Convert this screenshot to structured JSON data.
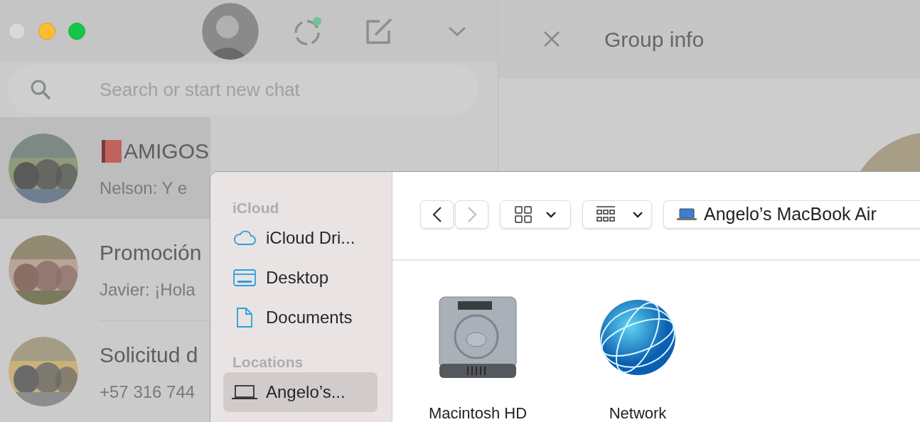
{
  "search": {
    "placeholder": "Search or start new chat"
  },
  "chats": [
    {
      "title": "AMIGOS",
      "preview": "Nelson: Y e",
      "selected": true
    },
    {
      "title": "Promoción",
      "preview": "Javier: ¡Hola",
      "selected": false
    },
    {
      "title": "Solicitud d",
      "preview": "+57 316 744",
      "selected": false
    }
  ],
  "group_info": {
    "title": "Group info"
  },
  "dialog": {
    "sidebar": [
      {
        "heading": "iCloud",
        "items": [
          {
            "label": "iCloud Dri...",
            "selected": false
          },
          {
            "label": "Desktop",
            "selected": false
          },
          {
            "label": "Documents",
            "selected": false
          }
        ]
      },
      {
        "heading": "Locations",
        "items": [
          {
            "label": "Angelo’s...",
            "selected": true
          }
        ]
      }
    ],
    "toolbar": {
      "back": {
        "disabled": false
      },
      "forward": {
        "disabled": true
      },
      "location": "Angelo’s MacBook Air"
    },
    "files": [
      {
        "name": "Macintosh HD",
        "kind": "disk"
      },
      {
        "name": "Network",
        "kind": "network"
      }
    ]
  }
}
